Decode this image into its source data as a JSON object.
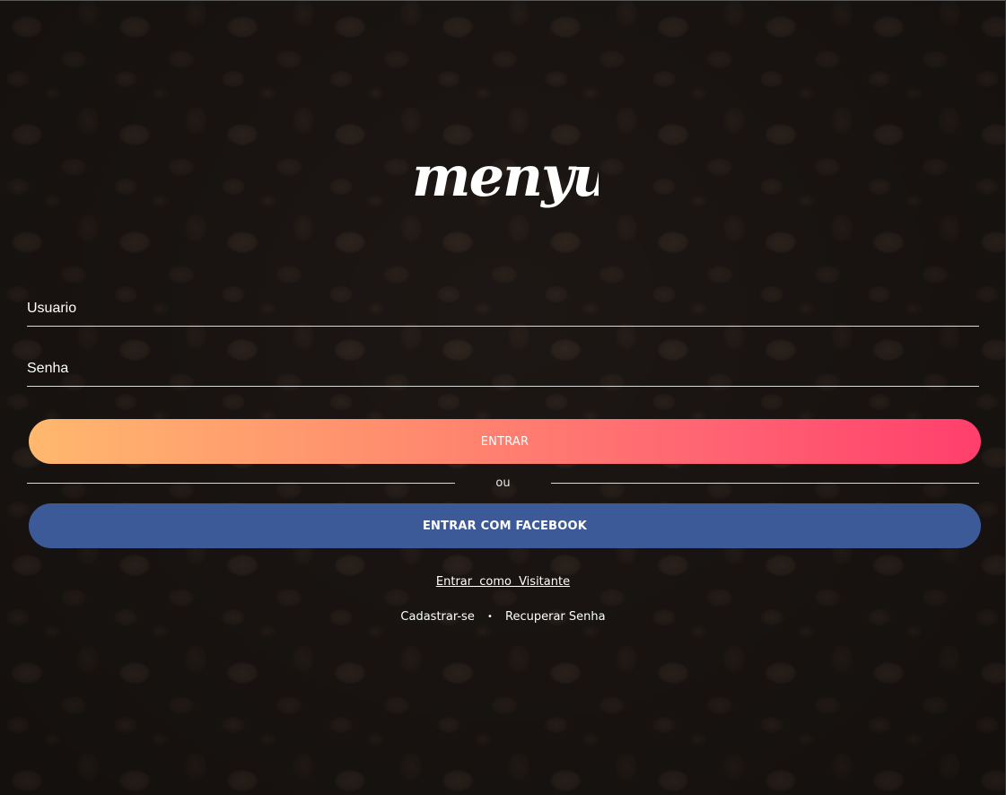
{
  "brand": {
    "logo_text": "menyu"
  },
  "login_form": {
    "username_placeholder": "Usuario",
    "password_placeholder": "Senha",
    "login_button": "ENTRAR",
    "divider_text": "ou",
    "facebook_button": "ENTRAR COM FACEBOOK"
  },
  "links": {
    "guest": "Entrar como Visitante",
    "signup": "Cadastrar-se",
    "separator": "•",
    "recover_password": "Recuperar Senha"
  },
  "colors": {
    "login_gradient_start": "#ffb86e",
    "login_gradient_end": "#ff3f6c",
    "facebook_blue": "#3d5a98",
    "background": "#1e1815"
  }
}
